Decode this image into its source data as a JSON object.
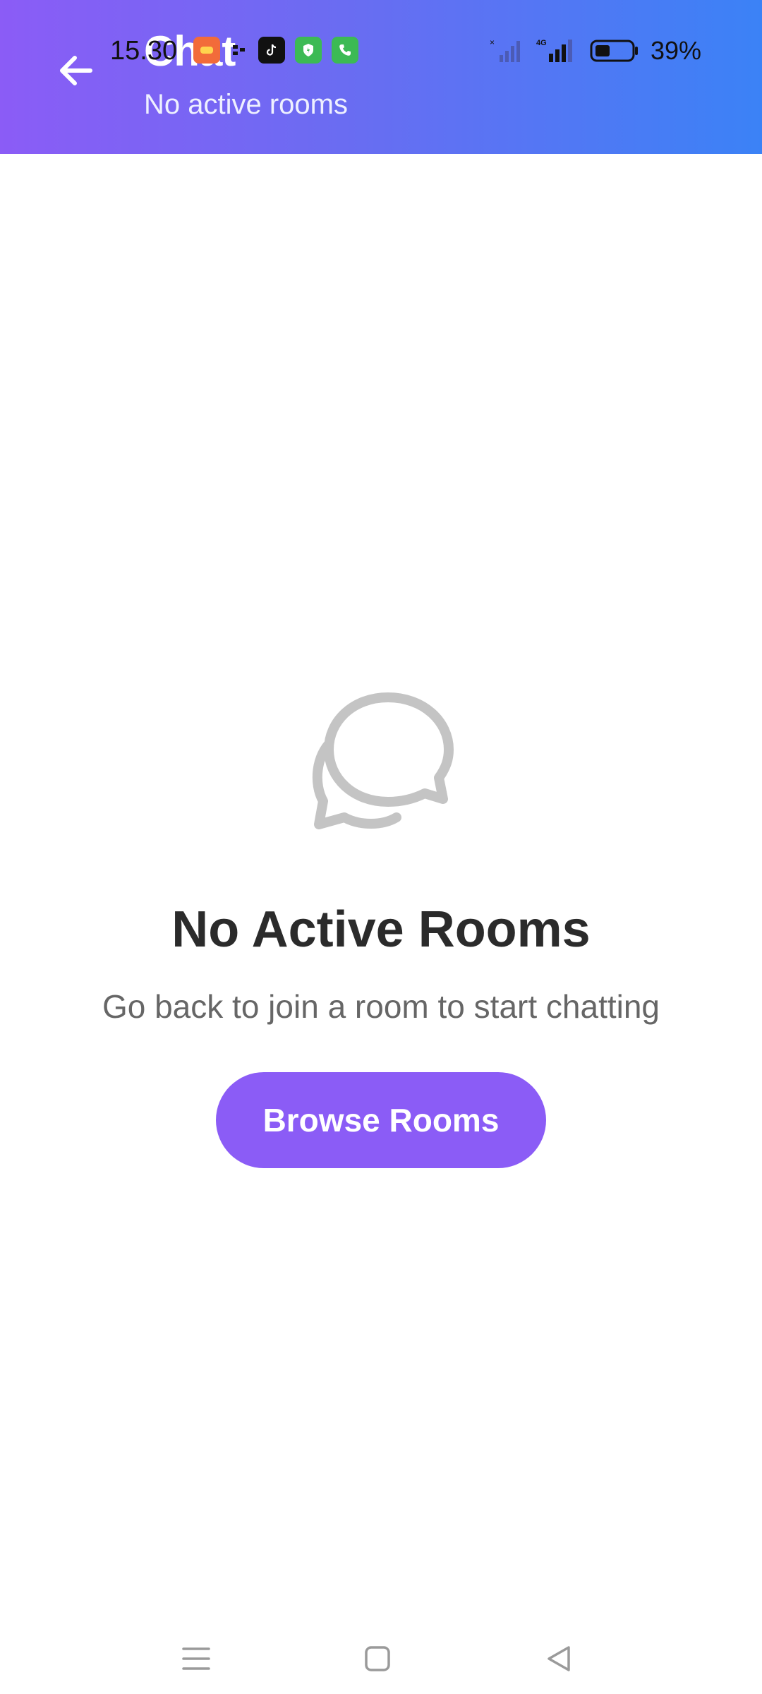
{
  "header": {
    "title": "Chat",
    "subtitle": "No active rooms",
    "back_icon": "arrow-left-icon",
    "gradient_start": "#8b5cf6",
    "gradient_end": "#3b82f6"
  },
  "status_bar": {
    "time": "15.30",
    "battery_percent": "39%",
    "network_label": "4G",
    "notification_icons": [
      "game-app-icon",
      "dots-icon",
      "tiktok-icon",
      "shield-app-icon",
      "phone-app-icon"
    ]
  },
  "empty_state": {
    "icon": "chat-bubbles-icon",
    "title": "No Active Rooms",
    "description": "Go back to join a room to start chatting",
    "button_label": "Browse Rooms",
    "accent_color": "#8b5cf6"
  },
  "nav_bar": {
    "items": [
      "menu-icon",
      "home-square-icon",
      "back-triangle-icon"
    ]
  }
}
